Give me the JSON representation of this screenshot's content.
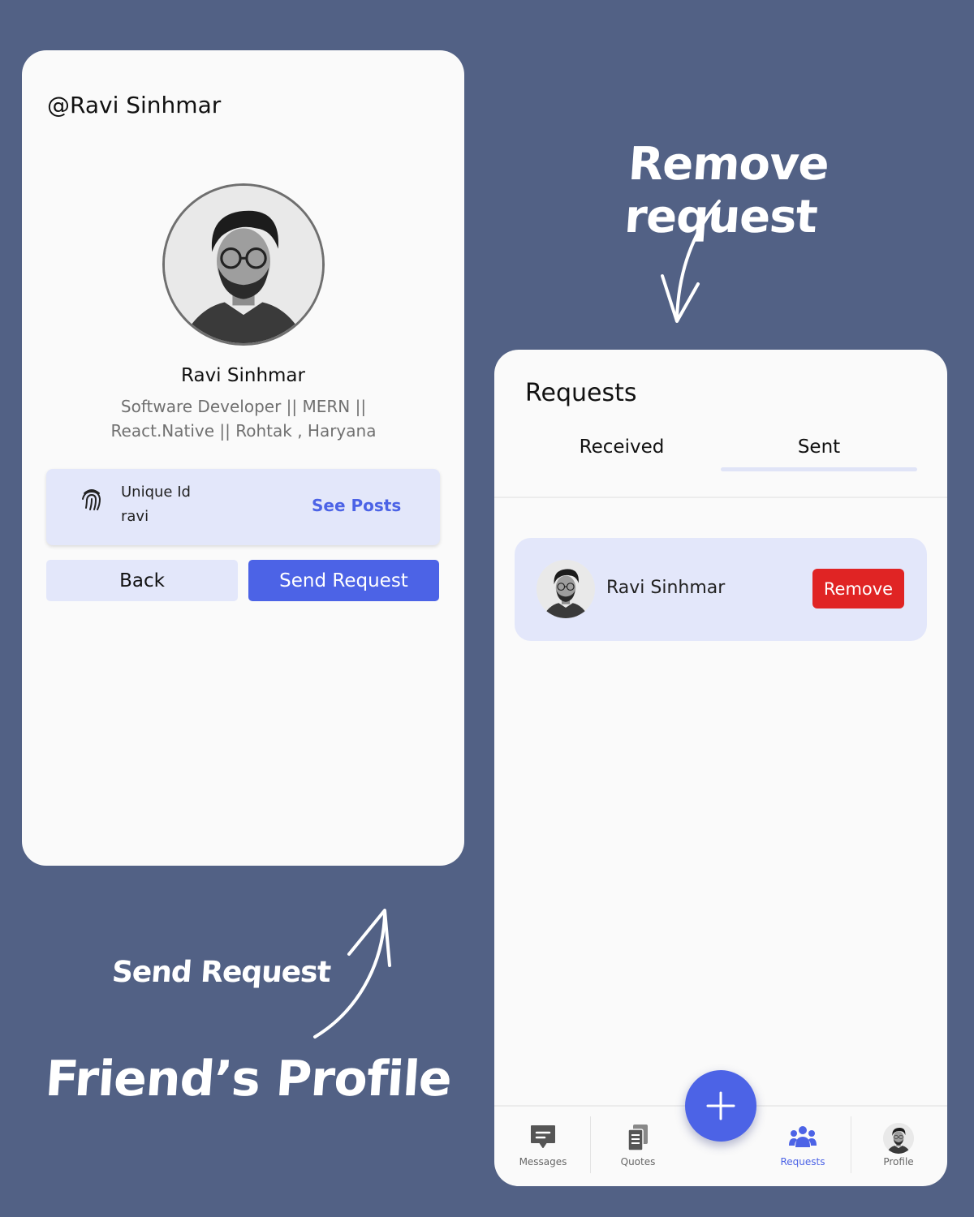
{
  "annotations": {
    "remove_request": "Remove request",
    "send_request": "Send Request",
    "friends_profile": "Friend’s Profile"
  },
  "profile_screen": {
    "handle": "@Ravi Sinhmar",
    "name": "Ravi Sinhmar",
    "bio": "Software Developer || MERN || React.Native || Rohtak , Haryana",
    "unique_id_label": "Unique Id",
    "unique_id_value": "ravi",
    "see_posts_label": "See Posts",
    "back_label": "Back",
    "send_request_label": "Send Request"
  },
  "requests_screen": {
    "title": "Requests",
    "tabs": [
      {
        "label": "Received",
        "active": false
      },
      {
        "label": "Sent",
        "active": true
      }
    ],
    "items": [
      {
        "name": "Ravi Sinhmar",
        "action_label": "Remove"
      }
    ],
    "nav": [
      {
        "label": "Messages",
        "icon": "message-icon"
      },
      {
        "label": "Quotes",
        "icon": "quotes-icon"
      },
      {
        "label": "Requests",
        "icon": "people-icon",
        "active": true
      },
      {
        "label": "Profile",
        "icon": "avatar"
      }
    ]
  },
  "colors": {
    "background": "#526185",
    "accent": "#4c63e6",
    "card_tint": "#e3e7fa",
    "danger": "#e02424"
  }
}
